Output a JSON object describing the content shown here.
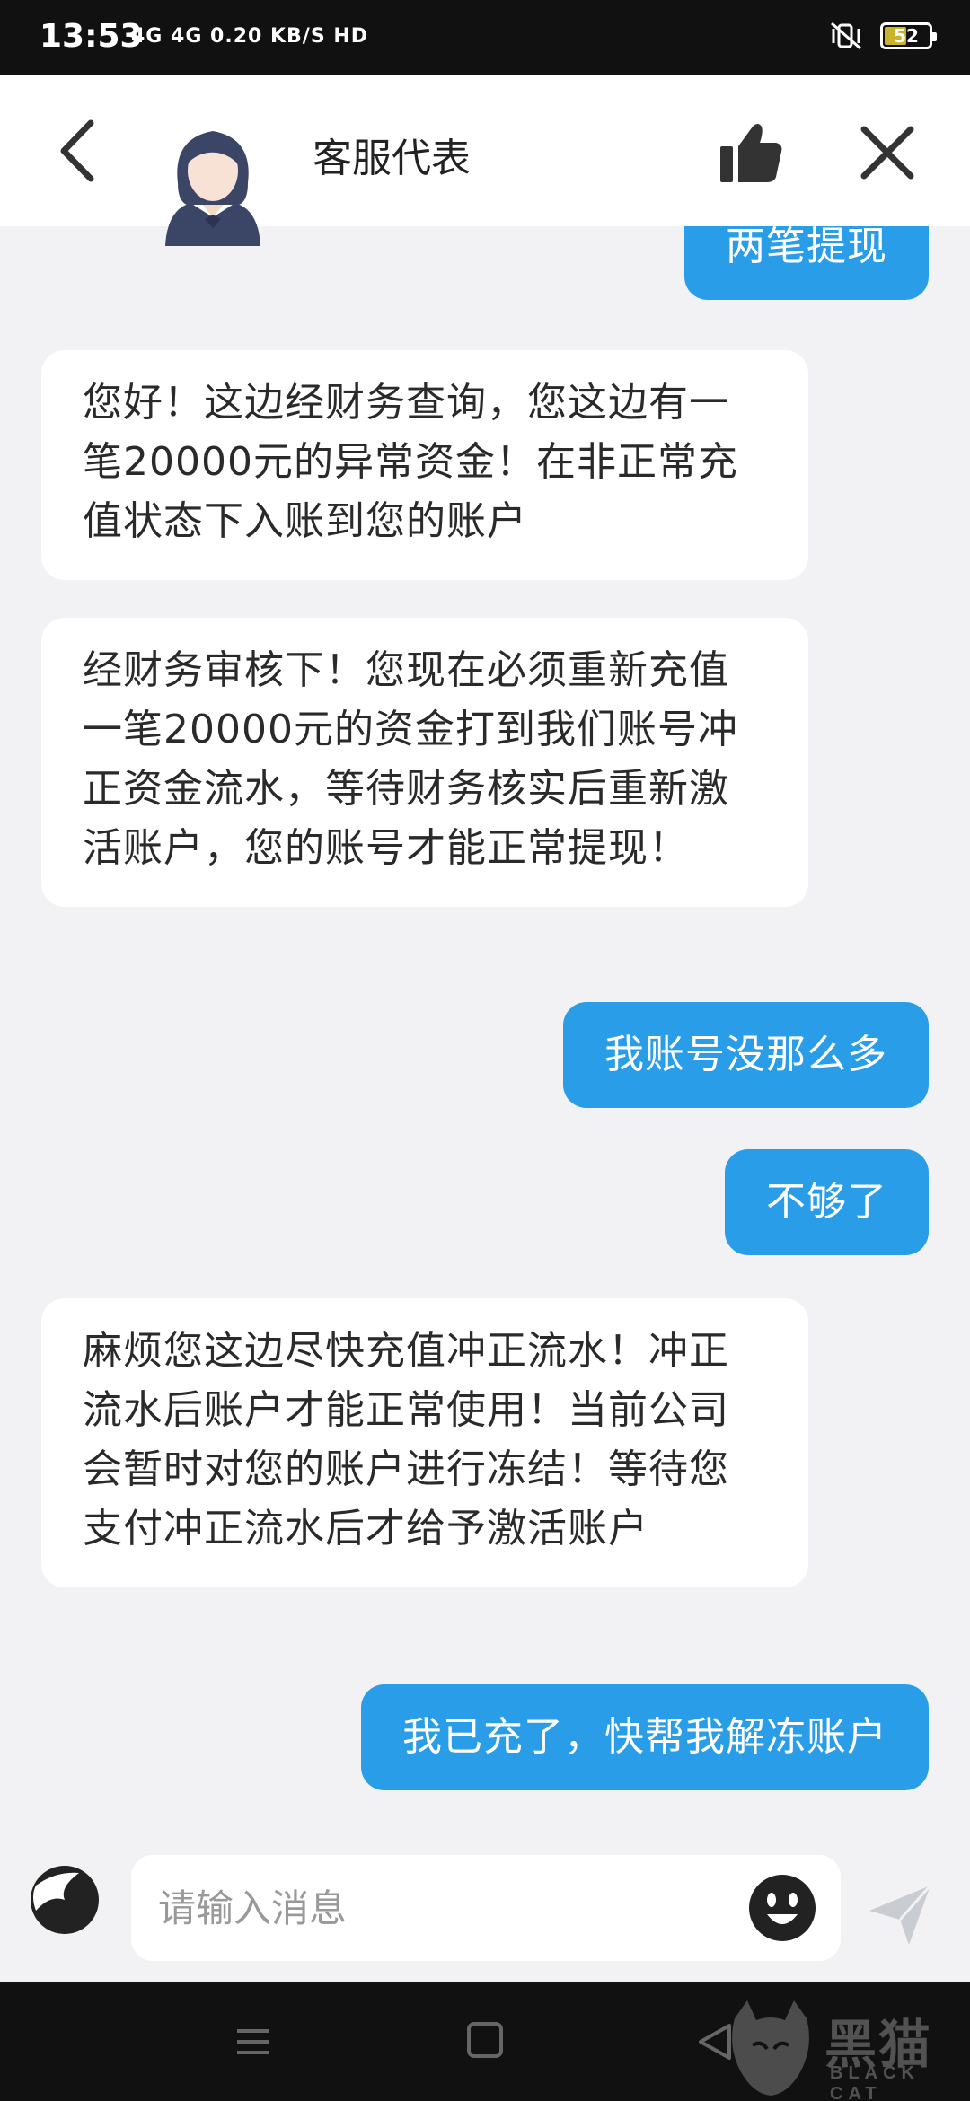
{
  "status_bar": {
    "time": "13:53",
    "signal_text": "4G 4G 0.20 KB/S HD",
    "battery": "52"
  },
  "header": {
    "title": "客服代表"
  },
  "messages": [
    {
      "side": "out",
      "text": "两笔提现"
    },
    {
      "side": "in",
      "text": "您好！这边经财务查询，您这边有一笔20000元的异常资金！在非正常充值状态下入账到您的账户"
    },
    {
      "side": "in",
      "text": "经财务审核下！您现在必须重新充值一笔20000元的资金打到我们账号冲正资金流水，等待财务核实后重新激活账户，您的账号才能正常提现！"
    },
    {
      "side": "out",
      "text": "我账号没那么多"
    },
    {
      "side": "out",
      "text": "不够了"
    },
    {
      "side": "in",
      "text": "麻烦您这边尽快充值冲正流水！冲正流水后账户才能正常使用！当前公司会暂时对您的账户进行冻结！等待您支付冲正流水后才给予激活账户"
    },
    {
      "side": "out",
      "text": "我已充了，快帮我解冻账户"
    }
  ],
  "input": {
    "placeholder": "请输入消息"
  },
  "watermark": {
    "title": "黑猫",
    "subtitle": "BLACK CAT"
  },
  "colors": {
    "accent": "#2a9de9",
    "background": "#f2f2f4"
  }
}
